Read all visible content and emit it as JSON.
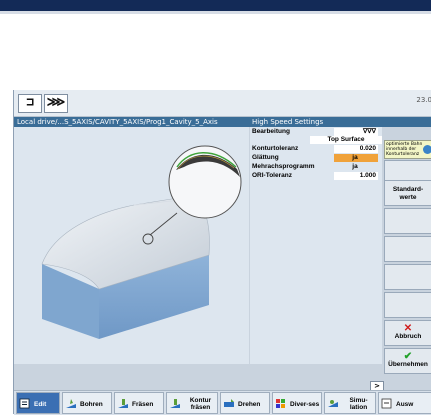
{
  "toolbar": {
    "btn1": "⊐",
    "btn2": "⋙",
    "clock": "23.0"
  },
  "pathbar": {
    "path": "Local drive/...S_5AXIS/CAVITY_5AXIS/Prog1_Cavity_5_Axis",
    "title": "High Speed Settings"
  },
  "params": {
    "bearbeitung_label": "Bearbeitung",
    "bearbeitung_value": "∇∇∇",
    "top_surface": "Top Surface",
    "konturtoleranz_label": "Konturtoleranz",
    "konturtoleranz_value": "0.020",
    "glaettung_label": "Glättung",
    "glaettung_value": "ja",
    "mehrachs_label": "Mehrachsprogramm",
    "mehrachs_value": "ja",
    "ori_label": "ORI-Toleranz",
    "ori_value": "1.000"
  },
  "hint": {
    "text": "optimierte Bahn innerhalb der Konturtoleranz"
  },
  "softkeys": {
    "standard": "Standard-werte",
    "abbruch": "Abbruch",
    "uebernehmen": "Übernehmen"
  },
  "bottombar": {
    "edit": "Edit",
    "bohren": "Bohren",
    "fraesen": "Fräsen",
    "kontur": "Kontur fräsen",
    "drehen": "Drehen",
    "divers": "Diver-ses",
    "simulation": "Simu-lation",
    "ausw": "Ausw"
  },
  "colors": {
    "accent_blue": "#3a6d97",
    "highlight_orange": "#f0a23a",
    "header_navy": "#132a57"
  }
}
